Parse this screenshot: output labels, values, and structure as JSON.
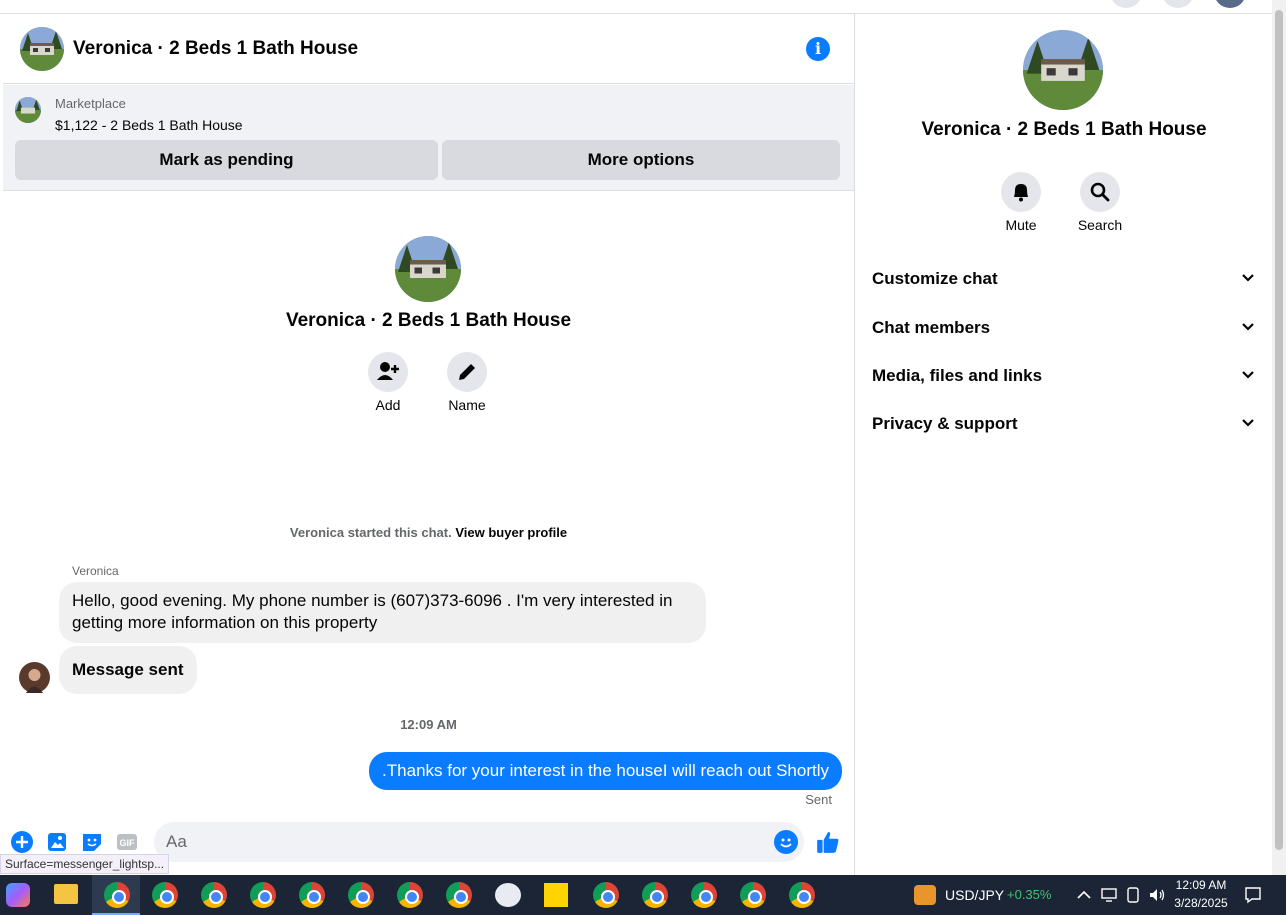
{
  "chat": {
    "title": "Veronica · 2 Beds 1 Bath House",
    "listing": {
      "source": "Marketplace",
      "price_title": "$1,122 - 2 Beds 1 Bath House",
      "mark_pending": "Mark as pending",
      "more_options": "More options"
    },
    "intro": {
      "title": "Veronica · 2 Beds 1 Bath House",
      "add_label": "Add",
      "name_label": "Name"
    },
    "started_text": "Veronica started this chat.",
    "view_profile": "View buyer profile",
    "sender_name": "Veronica",
    "messages_in": [
      "Hello, good evening. My phone number is (607)373-6096 . I'm very interested in getting more information on this property",
      "Message sent"
    ],
    "timestamp": "12:09 AM",
    "message_out": ".Thanks for your interest in the houseI will reach out Shortly",
    "sent_status": "Sent",
    "composer_placeholder": "Aa"
  },
  "status_tooltip": "Surface=messenger_lightsp...",
  "details": {
    "title": "Veronica · 2 Beds 1 Bath House",
    "mute_label": "Mute",
    "search_label": "Search",
    "sections": [
      "Customize chat",
      "Chat members",
      "Media, files and links",
      "Privacy & support"
    ]
  },
  "taskbar": {
    "ticker": "USD/JPY",
    "change": "+0.35%",
    "time": "12:09 AM",
    "date": "3/28/2025"
  },
  "colors": {
    "accent": "#0a7cff",
    "positive": "#3ec46d"
  }
}
